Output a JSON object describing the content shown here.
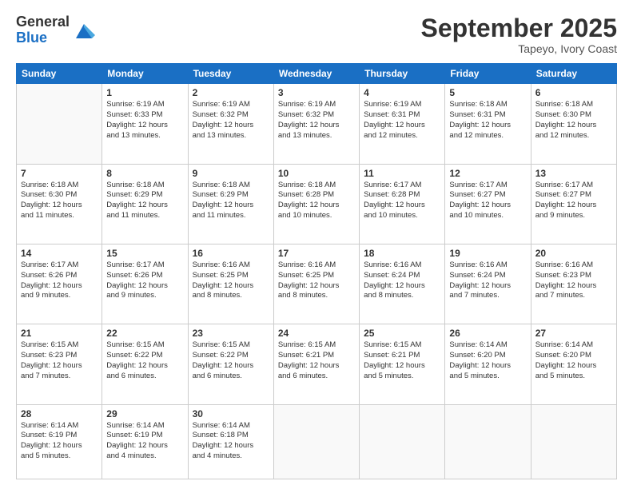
{
  "logo": {
    "general": "General",
    "blue": "Blue"
  },
  "title": "September 2025",
  "subtitle": "Tapeyo, Ivory Coast",
  "headers": [
    "Sunday",
    "Monday",
    "Tuesday",
    "Wednesday",
    "Thursday",
    "Friday",
    "Saturday"
  ],
  "weeks": [
    [
      {
        "day": "",
        "info": ""
      },
      {
        "day": "1",
        "info": "Sunrise: 6:19 AM\nSunset: 6:33 PM\nDaylight: 12 hours\nand 13 minutes."
      },
      {
        "day": "2",
        "info": "Sunrise: 6:19 AM\nSunset: 6:32 PM\nDaylight: 12 hours\nand 13 minutes."
      },
      {
        "day": "3",
        "info": "Sunrise: 6:19 AM\nSunset: 6:32 PM\nDaylight: 12 hours\nand 13 minutes."
      },
      {
        "day": "4",
        "info": "Sunrise: 6:19 AM\nSunset: 6:31 PM\nDaylight: 12 hours\nand 12 minutes."
      },
      {
        "day": "5",
        "info": "Sunrise: 6:18 AM\nSunset: 6:31 PM\nDaylight: 12 hours\nand 12 minutes."
      },
      {
        "day": "6",
        "info": "Sunrise: 6:18 AM\nSunset: 6:30 PM\nDaylight: 12 hours\nand 12 minutes."
      }
    ],
    [
      {
        "day": "7",
        "info": "Sunrise: 6:18 AM\nSunset: 6:30 PM\nDaylight: 12 hours\nand 11 minutes."
      },
      {
        "day": "8",
        "info": "Sunrise: 6:18 AM\nSunset: 6:29 PM\nDaylight: 12 hours\nand 11 minutes."
      },
      {
        "day": "9",
        "info": "Sunrise: 6:18 AM\nSunset: 6:29 PM\nDaylight: 12 hours\nand 11 minutes."
      },
      {
        "day": "10",
        "info": "Sunrise: 6:18 AM\nSunset: 6:28 PM\nDaylight: 12 hours\nand 10 minutes."
      },
      {
        "day": "11",
        "info": "Sunrise: 6:17 AM\nSunset: 6:28 PM\nDaylight: 12 hours\nand 10 minutes."
      },
      {
        "day": "12",
        "info": "Sunrise: 6:17 AM\nSunset: 6:27 PM\nDaylight: 12 hours\nand 10 minutes."
      },
      {
        "day": "13",
        "info": "Sunrise: 6:17 AM\nSunset: 6:27 PM\nDaylight: 12 hours\nand 9 minutes."
      }
    ],
    [
      {
        "day": "14",
        "info": "Sunrise: 6:17 AM\nSunset: 6:26 PM\nDaylight: 12 hours\nand 9 minutes."
      },
      {
        "day": "15",
        "info": "Sunrise: 6:17 AM\nSunset: 6:26 PM\nDaylight: 12 hours\nand 9 minutes."
      },
      {
        "day": "16",
        "info": "Sunrise: 6:16 AM\nSunset: 6:25 PM\nDaylight: 12 hours\nand 8 minutes."
      },
      {
        "day": "17",
        "info": "Sunrise: 6:16 AM\nSunset: 6:25 PM\nDaylight: 12 hours\nand 8 minutes."
      },
      {
        "day": "18",
        "info": "Sunrise: 6:16 AM\nSunset: 6:24 PM\nDaylight: 12 hours\nand 8 minutes."
      },
      {
        "day": "19",
        "info": "Sunrise: 6:16 AM\nSunset: 6:24 PM\nDaylight: 12 hours\nand 7 minutes."
      },
      {
        "day": "20",
        "info": "Sunrise: 6:16 AM\nSunset: 6:23 PM\nDaylight: 12 hours\nand 7 minutes."
      }
    ],
    [
      {
        "day": "21",
        "info": "Sunrise: 6:15 AM\nSunset: 6:23 PM\nDaylight: 12 hours\nand 7 minutes."
      },
      {
        "day": "22",
        "info": "Sunrise: 6:15 AM\nSunset: 6:22 PM\nDaylight: 12 hours\nand 6 minutes."
      },
      {
        "day": "23",
        "info": "Sunrise: 6:15 AM\nSunset: 6:22 PM\nDaylight: 12 hours\nand 6 minutes."
      },
      {
        "day": "24",
        "info": "Sunrise: 6:15 AM\nSunset: 6:21 PM\nDaylight: 12 hours\nand 6 minutes."
      },
      {
        "day": "25",
        "info": "Sunrise: 6:15 AM\nSunset: 6:21 PM\nDaylight: 12 hours\nand 5 minutes."
      },
      {
        "day": "26",
        "info": "Sunrise: 6:14 AM\nSunset: 6:20 PM\nDaylight: 12 hours\nand 5 minutes."
      },
      {
        "day": "27",
        "info": "Sunrise: 6:14 AM\nSunset: 6:20 PM\nDaylight: 12 hours\nand 5 minutes."
      }
    ],
    [
      {
        "day": "28",
        "info": "Sunrise: 6:14 AM\nSunset: 6:19 PM\nDaylight: 12 hours\nand 5 minutes."
      },
      {
        "day": "29",
        "info": "Sunrise: 6:14 AM\nSunset: 6:19 PM\nDaylight: 12 hours\nand 4 minutes."
      },
      {
        "day": "30",
        "info": "Sunrise: 6:14 AM\nSunset: 6:18 PM\nDaylight: 12 hours\nand 4 minutes."
      },
      {
        "day": "",
        "info": ""
      },
      {
        "day": "",
        "info": ""
      },
      {
        "day": "",
        "info": ""
      },
      {
        "day": "",
        "info": ""
      }
    ]
  ]
}
